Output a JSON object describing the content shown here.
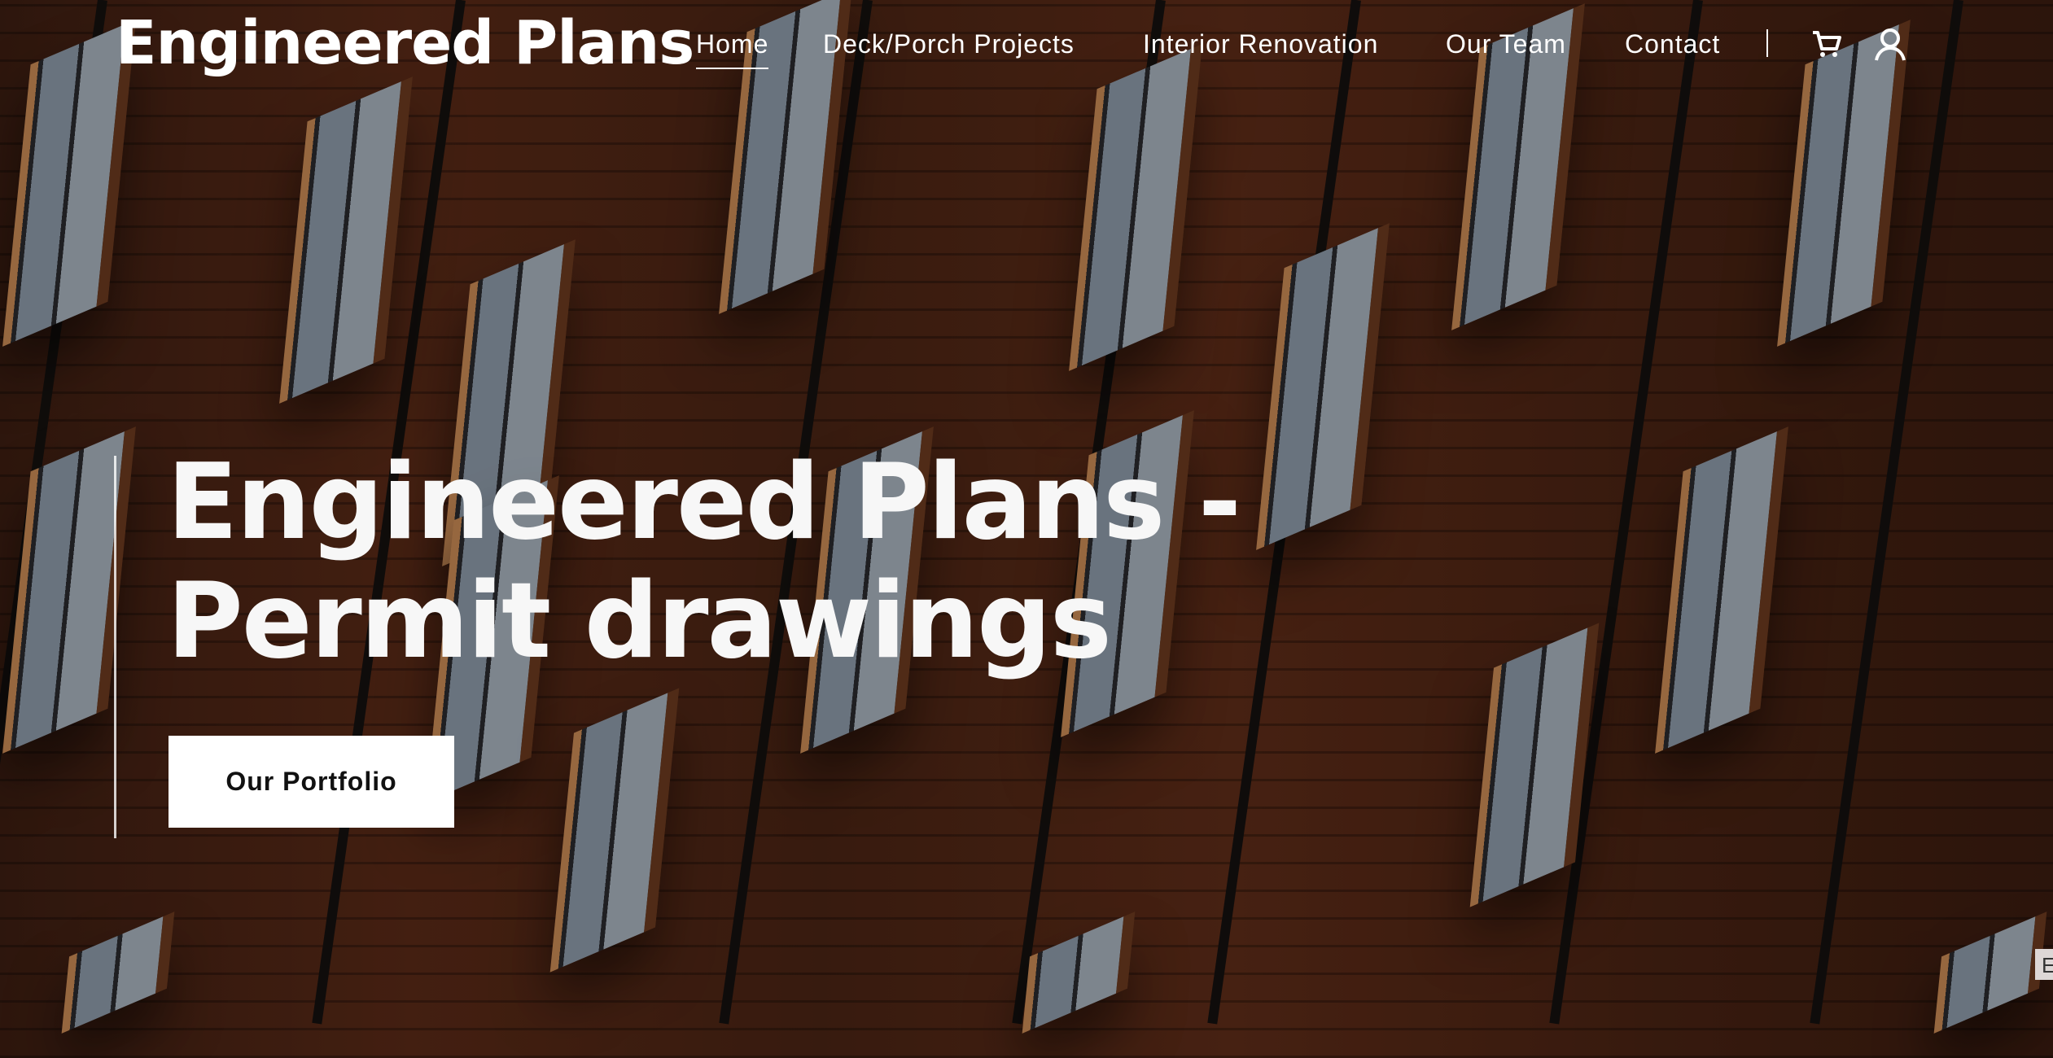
{
  "header": {
    "logo": "Engineered Plans",
    "nav": [
      {
        "label": "Home",
        "active": true
      },
      {
        "label": "Deck/Porch Projects"
      },
      {
        "label": "Interior Renovation"
      },
      {
        "label": "Our Team"
      },
      {
        "label": "Contact"
      }
    ],
    "icons": [
      "cart-icon",
      "user-icon"
    ]
  },
  "hero": {
    "title": "Engineered Plans - Permit drawings",
    "button": "Our Portfolio"
  },
  "badge": {
    "text": "E"
  },
  "colors": {
    "button_bg": "#ffffff",
    "text": "#ffffff"
  }
}
